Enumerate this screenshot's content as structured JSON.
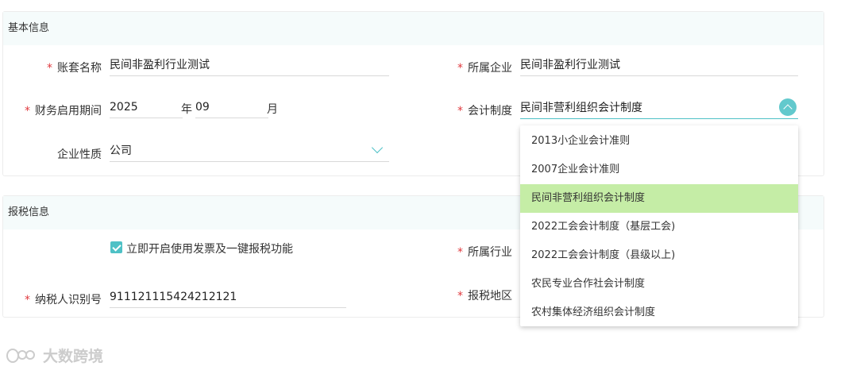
{
  "basic": {
    "title": "基本信息",
    "account_name": {
      "label": "账套名称",
      "value": "民间非盈利行业测试",
      "required": true
    },
    "company": {
      "label": "所属企业",
      "value": "民间非盈利行业测试",
      "required": true
    },
    "period": {
      "label": "财务启用期间",
      "year": "2025",
      "year_unit": "年",
      "month": "09",
      "month_unit": "月",
      "required": true
    },
    "accounting_system": {
      "label": "会计制度",
      "value": "民间非营利组织会计制度",
      "required": true
    },
    "enterprise_type": {
      "label": "企业性质",
      "value": "公司",
      "required": false
    }
  },
  "tax": {
    "title": "报税信息",
    "enable_invoice": {
      "label": "立即开启使用发票及一键报税功能",
      "checked": true
    },
    "industry": {
      "label": "所属行业",
      "value": "",
      "required": true
    },
    "taxpayer_id": {
      "label": "纳税人识别号",
      "value": "911121115424212121",
      "required": true
    },
    "region": {
      "label": "报税地区",
      "value": "",
      "required": true
    }
  },
  "dropdown": {
    "options": [
      "2013小企业会计准则",
      "2007企业会计准则",
      "民间非营利组织会计制度",
      "2022工会会计制度（基层工会)",
      "2022工会会计制度（县级以上)",
      "农民专业合作社会计制度",
      "农村集体经济组织会计制度"
    ],
    "selected": "民间非营利组织会计制度"
  },
  "watermark": {
    "text": "大数跨境"
  },
  "colors": {
    "accent": "#4ec1c6",
    "required": "#e0393e",
    "selected_bg": "#c5eda6",
    "header_bg": "#f5fbfb"
  },
  "icons": {
    "select_arrow": "chevron-down-icon",
    "select_open": "chevron-up-icon",
    "checkbox": "checkbox-checked-icon"
  }
}
